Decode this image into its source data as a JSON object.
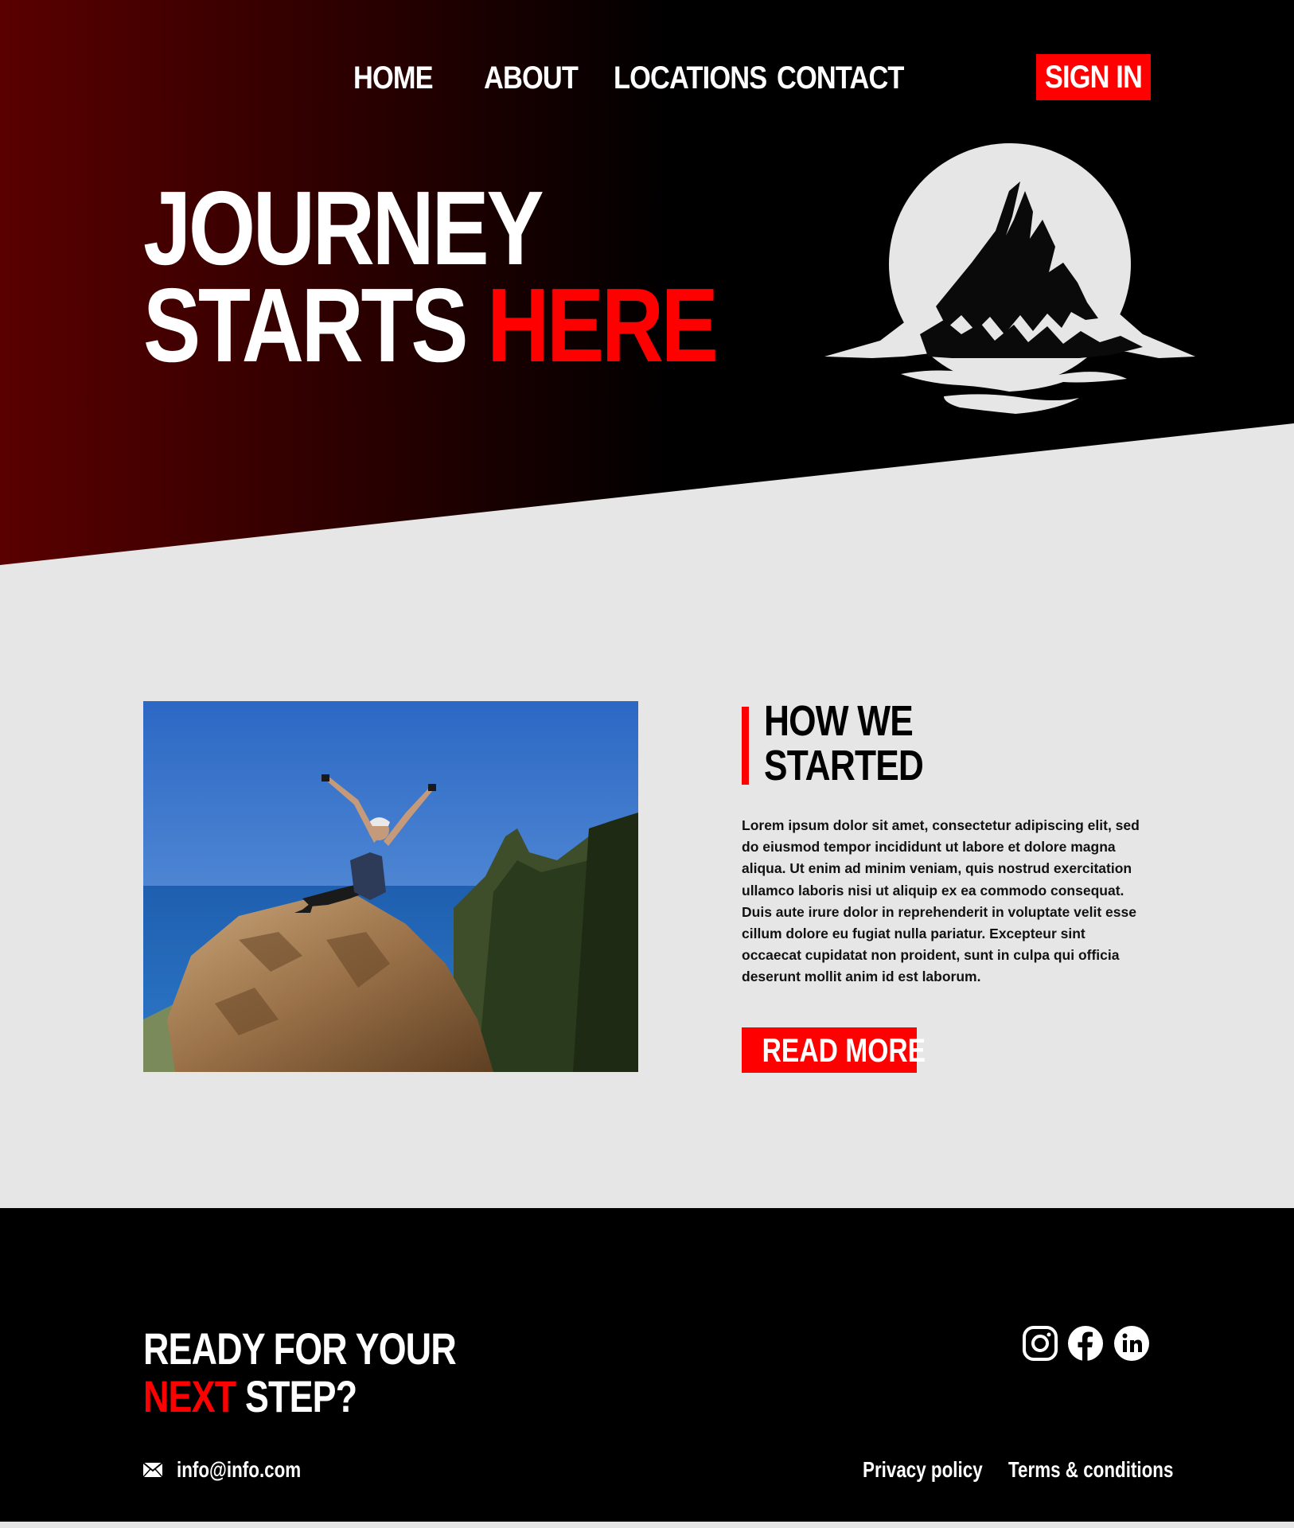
{
  "nav": {
    "items": [
      {
        "label": "HOME"
      },
      {
        "label": "ABOUT"
      },
      {
        "label": "LOCATIONS"
      },
      {
        "label": "CONTACT"
      }
    ],
    "sign_in_label": "SIGN IN"
  },
  "hero": {
    "line1": "JOURNEY",
    "line2_white": "STARTS",
    "line2_red": "HERE",
    "logo_icon": "mountain-logo-icon"
  },
  "about": {
    "title_line1": "HOW WE",
    "title_line2": "STARTED",
    "body": "Lorem ipsum dolor sit amet, consectetur adipiscing elit, sed do eiusmod tempor incididunt ut labore et dolore magna aliqua. Ut enim ad minim veniam, quis nostrud exercitation ullamco laboris nisi ut aliquip ex ea commodo consequat. Duis aute irure dolor in reprehenderit in voluptate velit esse cillum dolore eu fugiat nulla pariatur. Excepteur sint occaecat cupidatat non proident, sunt in culpa qui officia deserunt mollit anim id est laborum.",
    "read_more_label": "READ  MORE",
    "photo": "hiker-on-rock-photo"
  },
  "footer": {
    "cta_line1": "READY FOR YOUR",
    "cta_red": "NEXT",
    "cta_white": "STEP?",
    "email": "info@info.com",
    "links": [
      {
        "label": "Privacy policy"
      },
      {
        "label": "Terms & conditions"
      }
    ],
    "social": [
      "instagram-icon",
      "facebook-icon",
      "linkedin-icon"
    ]
  },
  "colors": {
    "accent": "#ff0000",
    "hero_gradient_start": "#5a0000",
    "background": "#000000",
    "content_bg": "#e6e6e6"
  }
}
